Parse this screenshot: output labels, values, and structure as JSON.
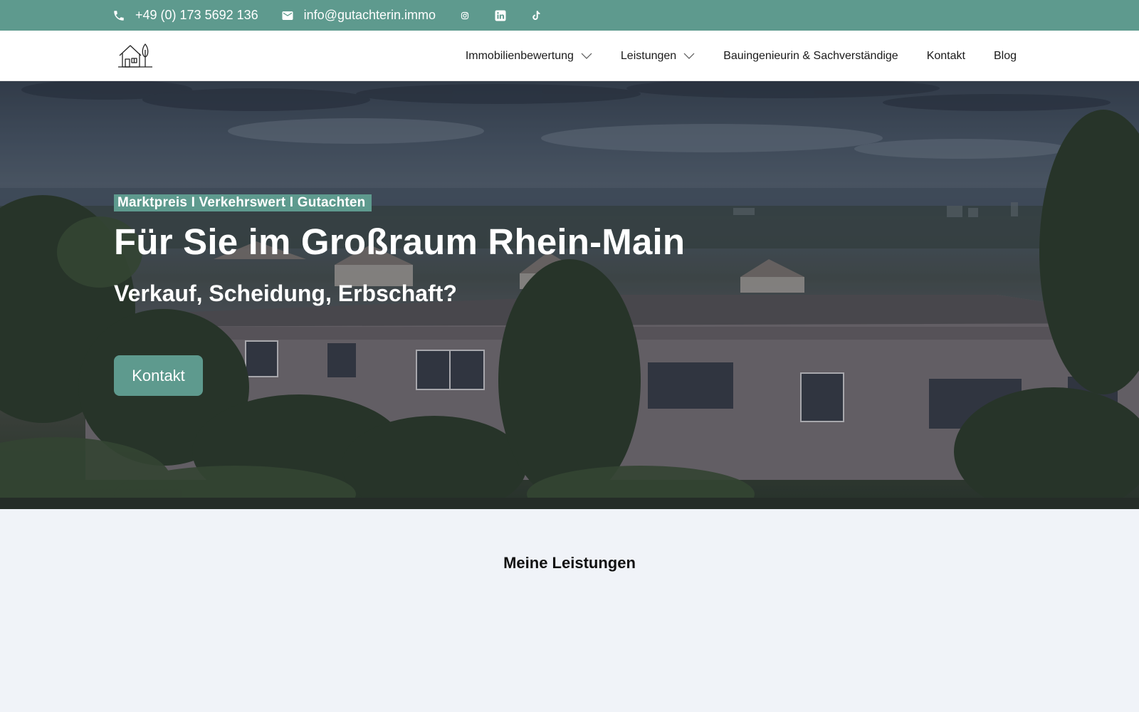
{
  "topbar": {
    "phone": "+49 (0) 173 5692 136",
    "email": "info@gutachterin.immo",
    "icons": [
      "phone-icon",
      "mail-icon",
      "instagram-icon",
      "linkedin-icon",
      "tiktok-icon"
    ]
  },
  "header": {
    "logo_icon": "house-tree-logo",
    "nav": [
      {
        "label": "Immobilienbewertung",
        "has_dropdown": true
      },
      {
        "label": "Leistungen",
        "has_dropdown": true
      },
      {
        "label": "Bauingenieurin & Sachverständige",
        "has_dropdown": false
      },
      {
        "label": "Kontakt",
        "has_dropdown": false
      },
      {
        "label": "Blog",
        "has_dropdown": false
      }
    ]
  },
  "hero": {
    "eyebrow": "Marktpreis I  Verkehrswert I Gutachten",
    "title": "Für Sie im Großraum Rhein-Main",
    "subtitle": "Verkauf, Scheidung, Erbschaft?",
    "cta_label": "Kontakt"
  },
  "section": {
    "title": "Meine Leistungen"
  },
  "colors": {
    "brand": "#5e9a8e",
    "background": "#f0f3f8",
    "header_bg": "#ffffff",
    "text": "#111111"
  }
}
